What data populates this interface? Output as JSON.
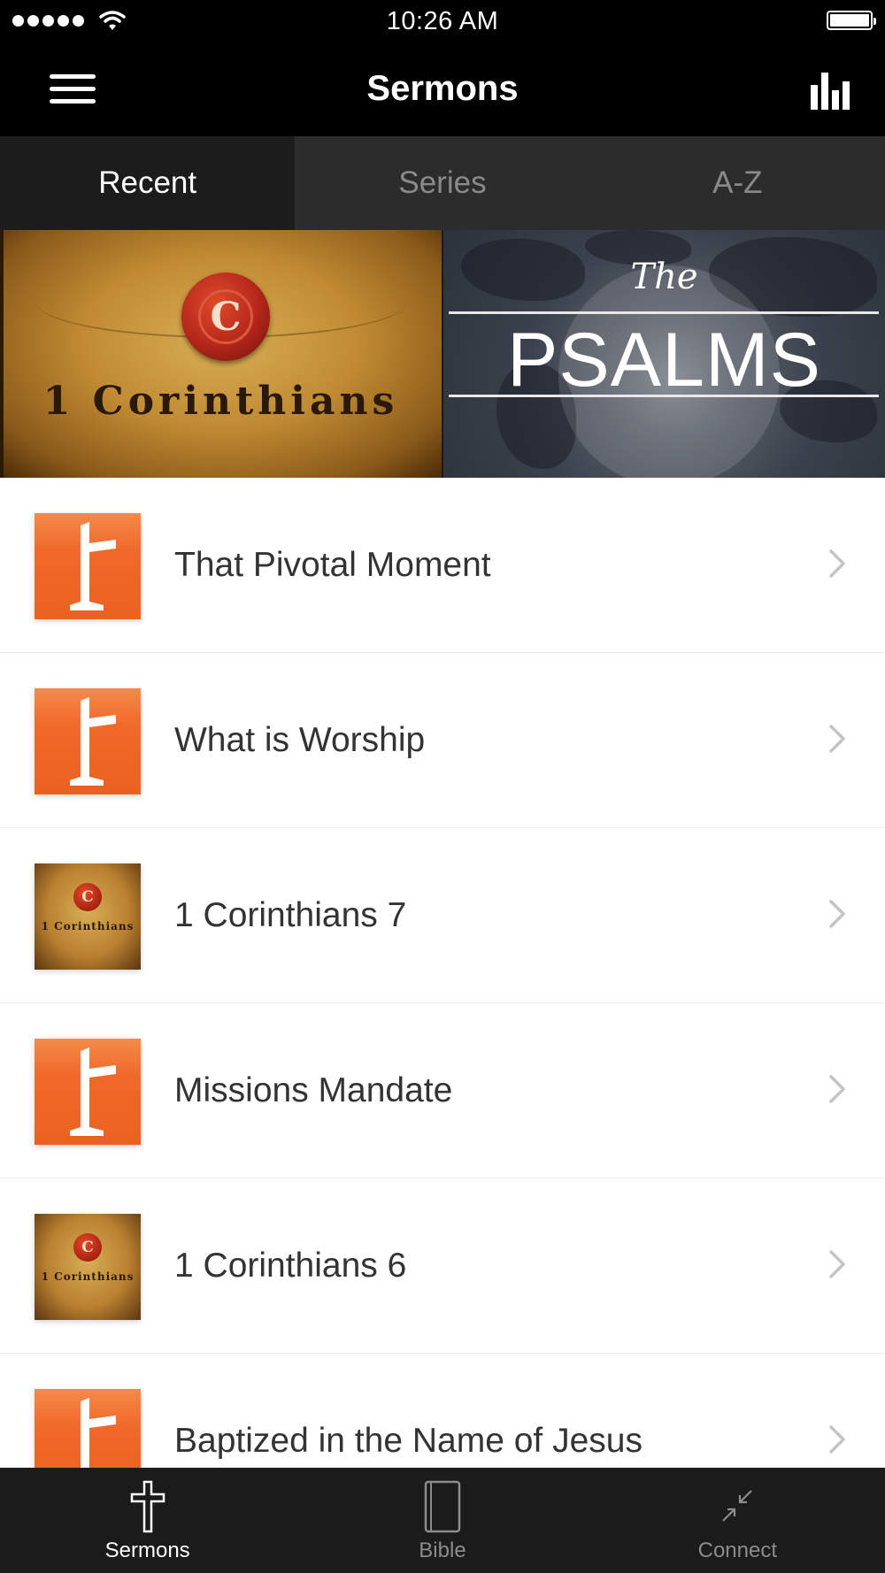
{
  "status_bar": {
    "time": "10:26 AM"
  },
  "nav": {
    "title": "Sermons"
  },
  "segments": [
    {
      "label": "Recent",
      "active": true
    },
    {
      "label": "Series",
      "active": false
    },
    {
      "label": "A-Z",
      "active": false
    }
  ],
  "banners": {
    "corinthians": {
      "seal_letter": "C",
      "title": "1 Corinthians"
    },
    "psalms": {
      "the": "The",
      "title": "PSALMS"
    }
  },
  "sermons": [
    {
      "title": "That Pivotal Moment",
      "thumb": "cross-icon"
    },
    {
      "title": "What is Worship",
      "thumb": "cross-icon"
    },
    {
      "title": "1 Corinthians 7",
      "thumb": "1-corinthians-artwork"
    },
    {
      "title": "Missions Mandate",
      "thumb": "cross-icon"
    },
    {
      "title": "1 Corinthians 6",
      "thumb": "1-corinthians-artwork"
    },
    {
      "title": "Baptized in the Name of Jesus",
      "thumb": "cross-icon"
    }
  ],
  "thumb_text": {
    "seal_letter": "C",
    "title": "1 Corinthians"
  },
  "tab_bar": [
    {
      "label": "Sermons",
      "icon": "cross-icon",
      "active": true
    },
    {
      "label": "Bible",
      "icon": "bible-icon",
      "active": false
    },
    {
      "label": "Connect",
      "icon": "connect-icon",
      "active": false
    }
  ],
  "colors": {
    "accent_orange": "#f0692a",
    "bar_black": "#000000",
    "tab_bar": "#1b1b1b"
  }
}
